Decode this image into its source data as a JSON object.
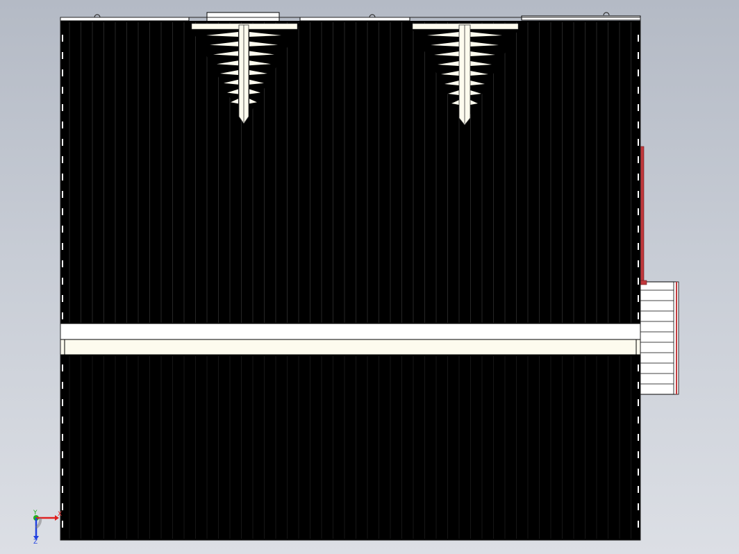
{
  "viewport": {
    "background_top": "#b4bac5",
    "background_bottom": "#dcdfe5"
  },
  "model": {
    "body_color": "#000000",
    "panel_color": "#fdfbee",
    "edge_color": "#ffffff",
    "accent_color": "#c0383c"
  },
  "triad": {
    "x_label": "X",
    "y_label": "Y",
    "z_label": "Z",
    "x_color": "#e02020",
    "y_color": "#20b020",
    "z_color": "#2040e0"
  }
}
